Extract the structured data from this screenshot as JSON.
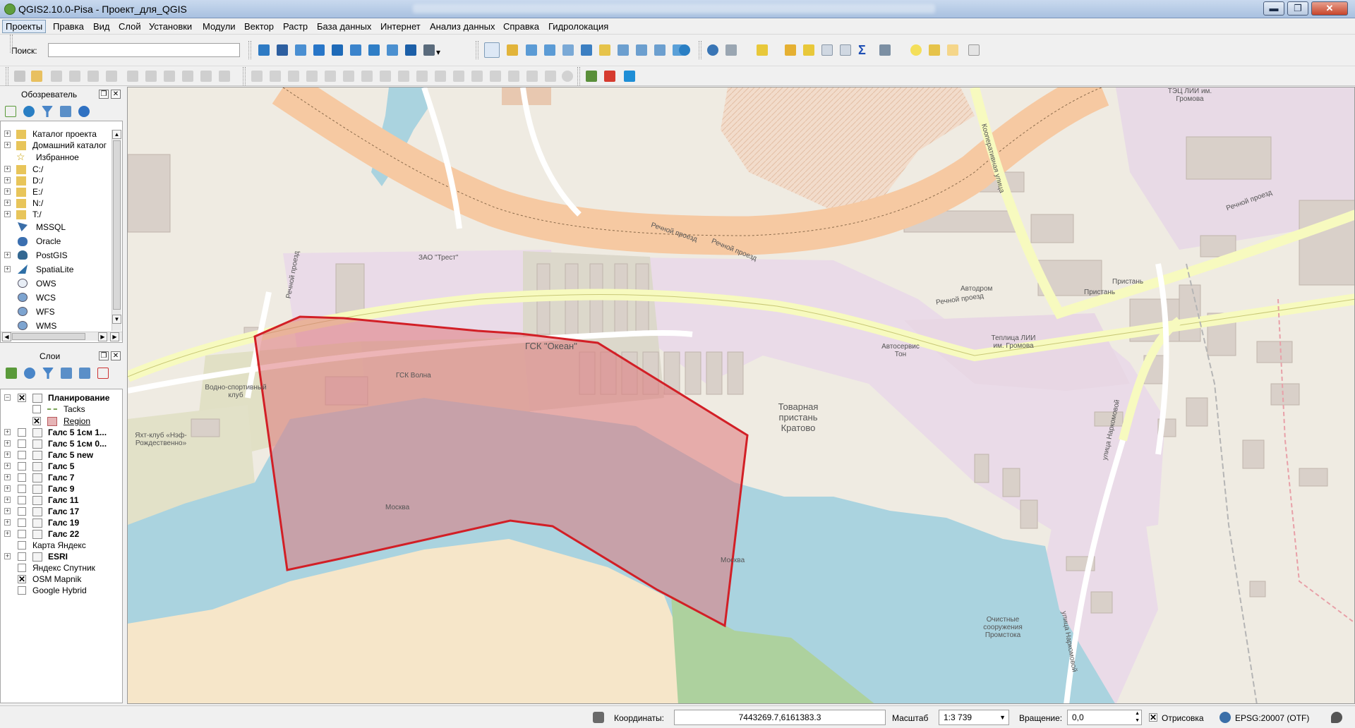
{
  "window": {
    "title": "QGIS2.10.0-Pisa - Проект_для_QGIS",
    "minimize": "▬",
    "maximize": "❐",
    "close": "✕"
  },
  "menu": [
    "Проекты",
    "Правка",
    "Вид",
    "Слой",
    "Установки",
    "Модули",
    "Вектор",
    "Растр",
    "База данных",
    "Интернет",
    "Анализ данных",
    "Справка",
    "Гидролокация"
  ],
  "search": {
    "label": "Поиск:",
    "value": ""
  },
  "browser": {
    "title": "Обозреватель",
    "items": [
      "Каталог проекта",
      "Домашний каталог",
      "Избранное",
      "C:/",
      "D:/",
      "E:/",
      "N:/",
      "T:/",
      "MSSQL",
      "Oracle",
      "PostGIS",
      "SpatiaLite",
      "OWS",
      "WCS",
      "WFS",
      "WMS"
    ]
  },
  "layers": {
    "title": "Слои",
    "group": "Планирование",
    "sublayers": [
      "Tacks",
      "Region"
    ],
    "items": [
      "Галс 5 1см 1...",
      "Галс 5 1см 0...",
      "Галс 5 new",
      "Галс 5",
      "Галс 7",
      "Галс 9",
      "Галс 11",
      "Галс 17",
      "Галс 19",
      "Галс 22"
    ],
    "extra": [
      "Карта Яндекс",
      "ESRI",
      "Яндекс Спутник",
      "OSM Mapnik",
      "Google Hybrid"
    ]
  },
  "map_labels": {
    "trest": "ЗАО \"Трест\"",
    "gsk_okean": "ГСК \"Океан\"",
    "gsk_volna": "ГСК Волна",
    "water_club": "Водно-спортивный клуб",
    "yacht_club": "Яхт-клуб «Нэф-Рождественно»",
    "pier": "Товарная пристань Кратово",
    "rechnoy1": "Речной проезд",
    "rechnoy2": "Речной проезд",
    "rechnoy3": "Речной проезд",
    "rechnoy4": "Речной проезд",
    "rechnoy5": "Речной проезд",
    "autoservice": "Автосервис Тон",
    "teplitsa": "Теплица ЛИИ им. Громова",
    "tets": "ТЭЦ ЛИИ им. Громова",
    "kooperativnaya": "Кооперативная улица",
    "naricinoy": "улица Наркомовой",
    "naricinoy2": "улица Наркомовой",
    "ochistnye": "Очистные сооружения Промстока",
    "pristan1": "Пристань",
    "pristan2": "Пристань",
    "avtodrom": "Автодром",
    "moskva1": "Москва",
    "moskva2": "Москва"
  },
  "status": {
    "coords_label": "Координаты:",
    "coords_value": "7443269.7,6161383.3",
    "scale_label": "Масштаб",
    "scale_value": "1:3 739",
    "rotation_label": "Вращение:",
    "rotation_value": "0,0",
    "render_label": "Отрисовка",
    "crs": "EPSG:20007 (OTF)"
  }
}
